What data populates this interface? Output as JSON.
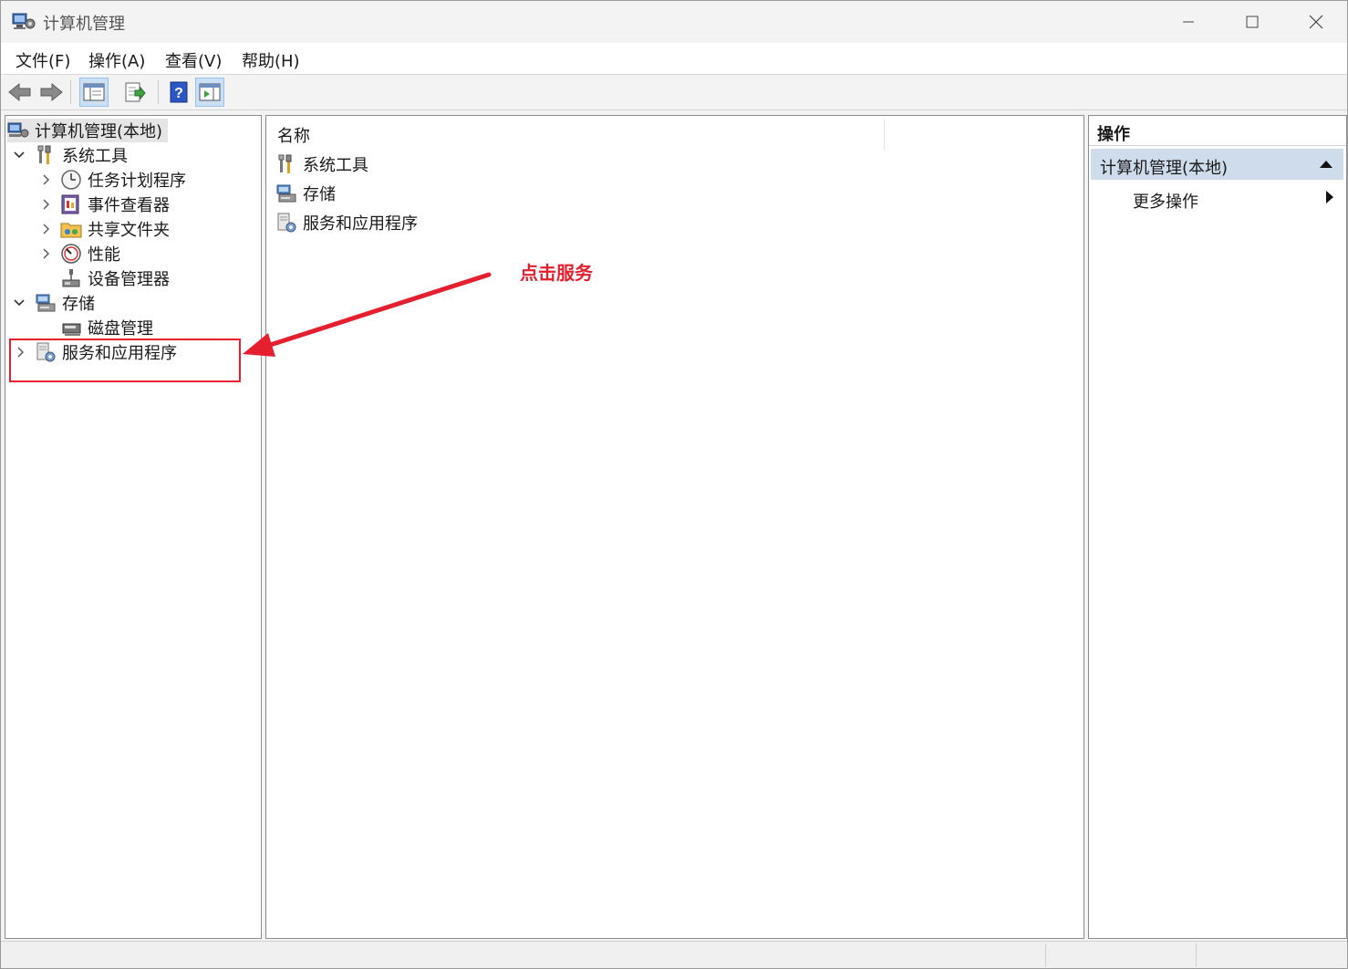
{
  "window": {
    "title": "计算机管理",
    "controls": {
      "minimize": "—",
      "maximize": "☐",
      "close": "✕"
    }
  },
  "menubar": {
    "items": [
      "文件(F)",
      "操作(A)",
      "查看(V)",
      "帮助(H)"
    ]
  },
  "toolbar": {
    "buttons": [
      "back-arrow-icon",
      "forward-arrow-icon",
      "show-tree-icon",
      "export-list-icon",
      "help-icon",
      "show-action-pane-icon"
    ]
  },
  "tree": {
    "root": "计算机管理(本地)",
    "system_tools": {
      "label": "系统工具",
      "children": [
        "任务计划程序",
        "事件查看器",
        "共享文件夹",
        "性能",
        "设备管理器"
      ]
    },
    "storage": {
      "label": "存储",
      "children": [
        "磁盘管理"
      ]
    },
    "services": {
      "label": "服务和应用程序"
    }
  },
  "list": {
    "column_header": "名称",
    "items": [
      "系统工具",
      "存储",
      "服务和应用程序"
    ]
  },
  "actions": {
    "title": "操作",
    "section": "计算机管理(本地)",
    "item": "更多操作"
  },
  "annotation": {
    "callout": "点击服务",
    "color": "#e5202e"
  }
}
